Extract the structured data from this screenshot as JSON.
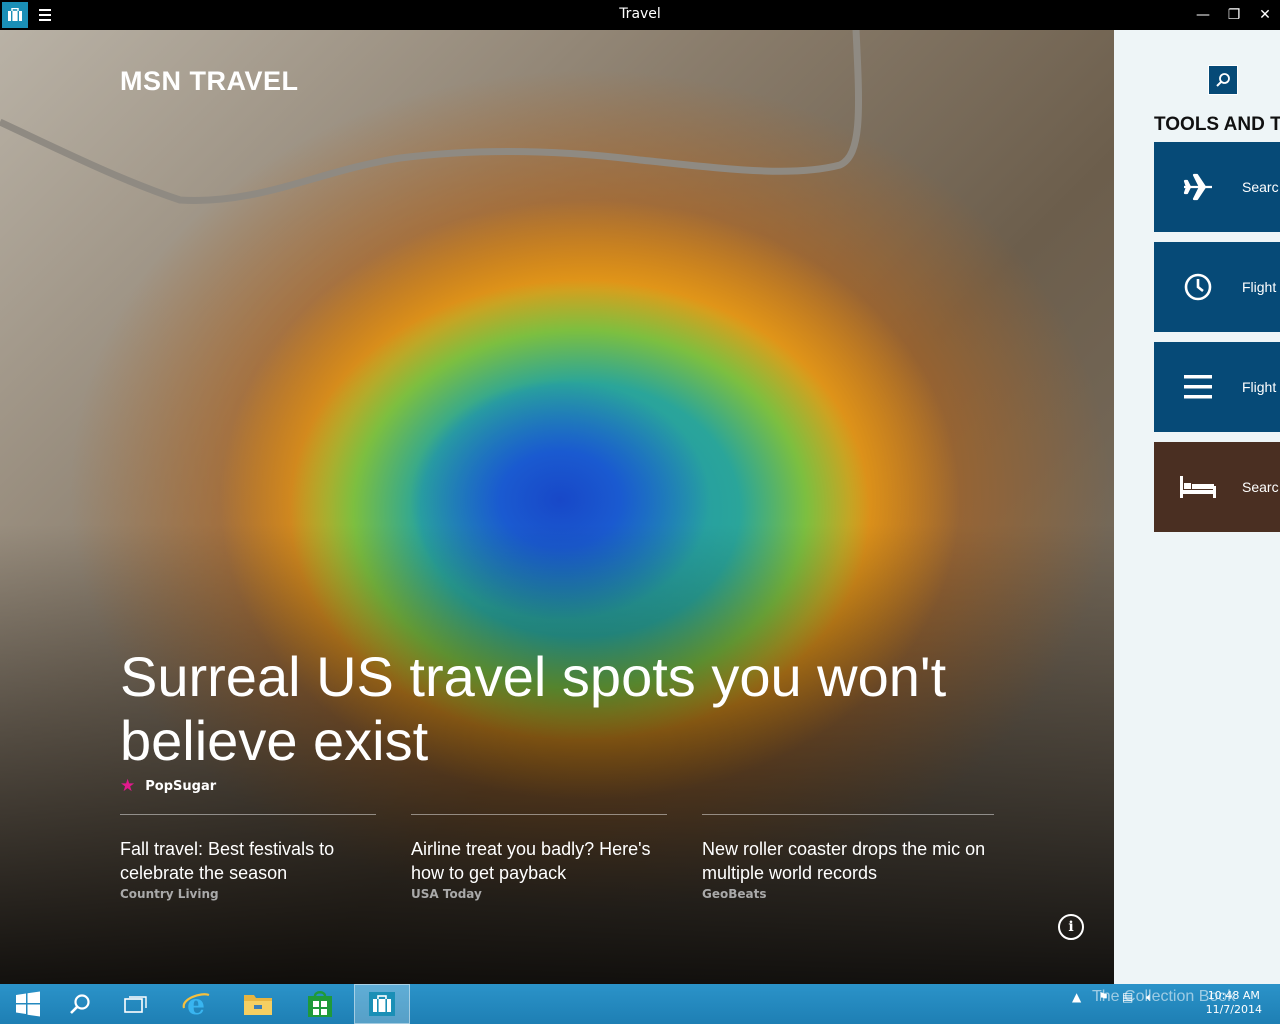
{
  "window": {
    "title": "Travel",
    "minimize_label": "—",
    "restore_label": "❐",
    "close_label": "✕"
  },
  "hero": {
    "brand": "MSN TRAVEL",
    "headline": "Surreal US travel spots you won't believe exist",
    "source": "PopSugar",
    "info_label": "i"
  },
  "stories": [
    {
      "title": "Fall travel: Best festivals to celebrate the season",
      "source": "Country Living"
    },
    {
      "title": "Airline treat you badly? Here's how to get payback",
      "source": "USA Today"
    },
    {
      "title": "New roller coaster drops the mic on multiple world records",
      "source": "GeoBeats"
    }
  ],
  "sidebar": {
    "heading": "TOOLS AND TA",
    "tiles": [
      {
        "label": "Searc",
        "icon": "airplane-icon",
        "color": "#064a77"
      },
      {
        "label": "Flight",
        "icon": "clock-icon",
        "color": "#064a77"
      },
      {
        "label": "Flight",
        "icon": "list-icon",
        "color": "#064a77"
      },
      {
        "label": "Searc",
        "icon": "bed-icon",
        "color": "#4a2f22"
      }
    ]
  },
  "taskbar": {
    "apps": [
      "start-icon",
      "search-icon",
      "task-view-icon",
      "internet-explorer-icon",
      "file-explorer-icon",
      "store-icon",
      "travel-app-icon"
    ],
    "watermark": "The Collection Book",
    "time": "10:48 AM",
    "date": "11/7/2014"
  }
}
